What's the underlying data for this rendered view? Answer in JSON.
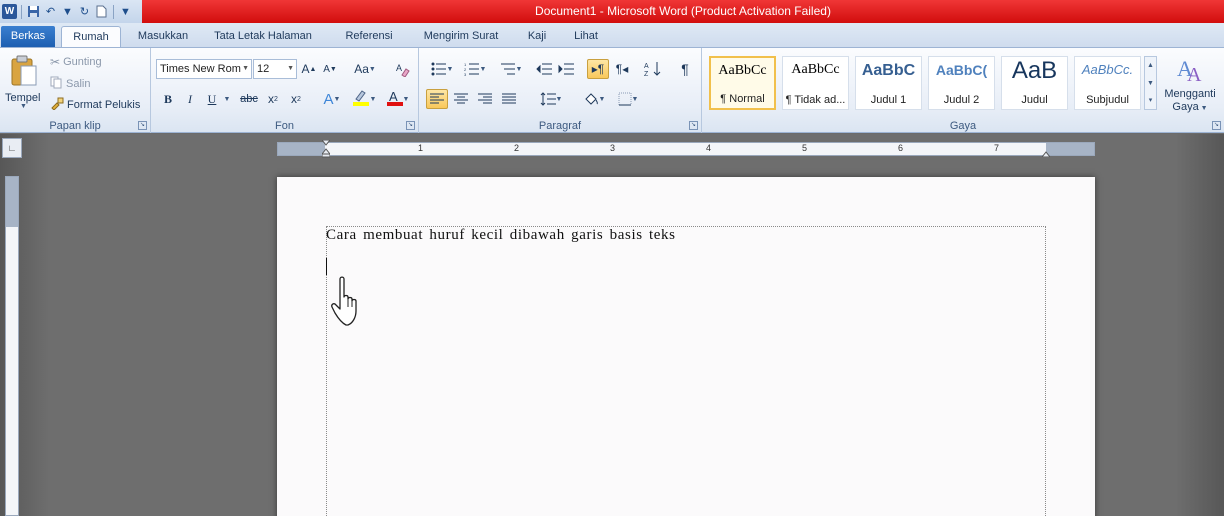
{
  "window": {
    "title": "Document1  -  Microsoft Word (Product Activation Failed)"
  },
  "tabs": [
    "Berkas",
    "Rumah",
    "Masukkan",
    "Tata Letak Halaman",
    "Referensi",
    "Mengirim Surat",
    "Kaji",
    "Lihat"
  ],
  "ribbon": {
    "clipboard": {
      "paste_label": "Tempel",
      "cut_label": "Gunting",
      "copy_label": "Salin",
      "format_painter_label": "Format Pelukis",
      "group_label": "Papan klip"
    },
    "font": {
      "font_name": "Times New Rom",
      "font_size": "12",
      "group_label": "Fon"
    },
    "paragraph": {
      "group_label": "Paragraf"
    },
    "styles": {
      "items": [
        {
          "sample": "AaBbCc",
          "name": "¶ Normal"
        },
        {
          "sample": "AaBbCc",
          "name": "¶ Tidak ad..."
        },
        {
          "sample": "AaBbC",
          "name": "Judul 1"
        },
        {
          "sample": "AaBbC(",
          "name": "Judul 2"
        },
        {
          "sample": "AaB",
          "name": "Judul"
        },
        {
          "sample": "AaBbCc.",
          "name": "Subjudul"
        }
      ],
      "change_label_1": "Mengganti",
      "change_label_2": "Gaya",
      "group_label": "Gaya"
    }
  },
  "ruler": {
    "numbers": [
      "1",
      "2",
      "3",
      "4",
      "5",
      "6",
      "7"
    ]
  },
  "document": {
    "line1": "Cara membuat huruf kecil dibawah garis basis teks"
  },
  "colors": {
    "titlebar": "#e31c1c",
    "file_tab": "#2a6fc2",
    "selected_style_border": "#f1c04c",
    "highlight_color": "#ffff00",
    "font_color": "#e01010"
  }
}
